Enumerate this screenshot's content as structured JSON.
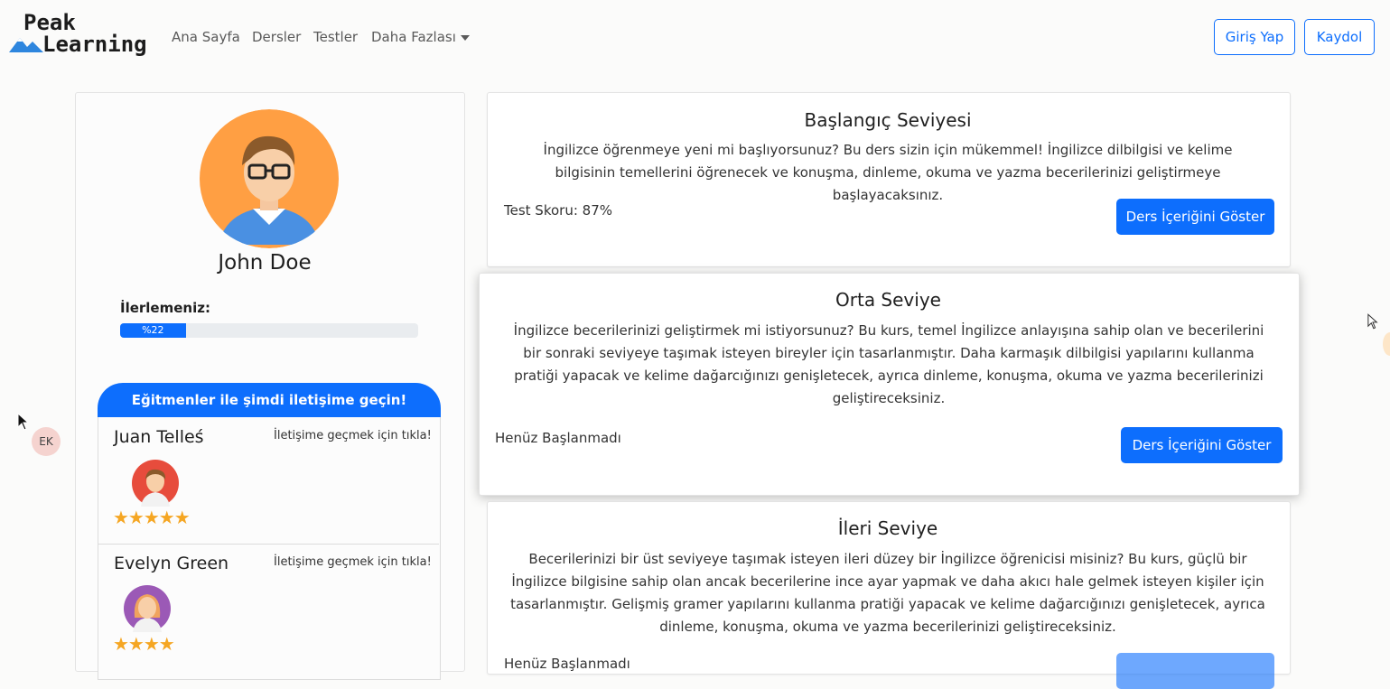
{
  "brand": {
    "line1": "Peak",
    "line2": "Learning"
  },
  "nav": {
    "home": "Ana Sayfa",
    "lessons": "Dersler",
    "tests": "Testler",
    "more": "Daha Fazlası",
    "login": "Giriş Yap",
    "register": "Kaydol"
  },
  "profile": {
    "name": "John Doe",
    "progress_label": "İlerlemeniz:",
    "progress_text": "%22",
    "progress_value": 0.22
  },
  "contact": {
    "header": "Eğitmenler ile şimdi iletişime geçin!",
    "instructors": [
      {
        "name": "Juan Telleś",
        "link": "İletişime geçmek için tıkla!",
        "rating": 5,
        "stars": "★★★★★"
      },
      {
        "name": "Evelyn Green",
        "link": "İletişime geçmek için tıkla!",
        "rating": 4,
        "stars": "★★★★"
      }
    ]
  },
  "levels": [
    {
      "title": "Başlangıç Seviyesi",
      "description": "İngilizce öğrenmeye yeni mi başlıyorsunuz? Bu ders sizin için mükemmel! İngilizce dilbilgisi ve kelime bilgisinin temellerini öğrenecek ve konuşma, dinleme, okuma ve yazma becerilerinizi geliştirmeye başlayacaksınız.",
      "status": "Test Skoru: 87%",
      "button": "Ders İçeriğini Göster"
    },
    {
      "title": "Orta Seviye",
      "description": "İngilizce becerilerinizi geliştirmek mi istiyorsunuz? Bu kurs, temel İngilizce anlayışına sahip olan ve becerilerini bir sonraki seviyeye taşımak isteyen bireyler için tasarlanmıştır. Daha karmaşık dilbilgisi yapılarını kullanma pratiği yapacak ve kelime dağarcığınızı genişletecek, ayrıca dinleme, konuşma, okuma ve yazma becerilerinizi geliştireceksiniz.",
      "status": "Henüz Başlanmadı",
      "button": "Ders İçeriğini Göster"
    },
    {
      "title": "İleri Seviye",
      "description": "Becerilerinizi bir üst seviyeye taşımak isteyen ileri düzey bir İngilizce öğrenicisi misiniz? Bu kurs, güçlü bir İngilizce bilgisine sahip olan ancak becerilerine ince ayar yapmak ve daha akıcı hale gelmek isteyen kişiler için tasarlanmıştır. Gelişmiş gramer yapılarını kullanma pratiği yapacak ve kelime dağarcığınızı genişletecek, ayrıca dinleme, konuşma, okuma ve yazma becerilerinizi geliştireceksiniz.",
      "status": "Henüz Başlanmadı"
    }
  ],
  "floating": {
    "initials": "EK"
  },
  "colors": {
    "primary": "#0d6efd",
    "star": "#f5a623",
    "avatar_bg": "#ff9f43"
  }
}
